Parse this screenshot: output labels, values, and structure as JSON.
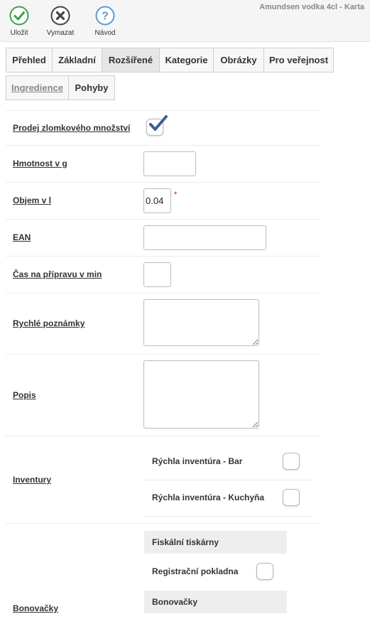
{
  "window": {
    "title": "Amundsen vodka 4cl - Karta"
  },
  "toolbar": {
    "save_label": "Uložit",
    "delete_label": "Vymazat",
    "help_label": "Návod",
    "colors": {
      "save": "#3aa24a",
      "delete": "#444444",
      "help": "#5a9ad6"
    }
  },
  "tabs": [
    {
      "label": "Přehled"
    },
    {
      "label": "Základní"
    },
    {
      "label": "Rozšířené",
      "active": true
    },
    {
      "label": "Kategorie"
    },
    {
      "label": "Obrázky"
    },
    {
      "label": "Pro veřejnost"
    },
    {
      "label": "Ingredience"
    },
    {
      "label": "Pohyby"
    }
  ],
  "form": {
    "fractional_sale": {
      "label": "Prodej zlomkového množství",
      "checked": true
    },
    "weight": {
      "label": "Hmotnost v g",
      "value": ""
    },
    "volume": {
      "label": "Objem v l",
      "value": "0.04",
      "required_mark": "*"
    },
    "ean": {
      "label": "EAN",
      "value": ""
    },
    "prep_time": {
      "label": "Čas na přípravu v min",
      "value": ""
    },
    "quick_notes": {
      "label": "Rychlé poznámky",
      "value": ""
    },
    "description": {
      "label": "Popis",
      "value": ""
    },
    "inventories": {
      "label": "Inventury",
      "items": [
        {
          "label": "Rýchla inventúra - Bar",
          "checked": false
        },
        {
          "label": "Rýchla inventúra - Kuchyňa",
          "checked": false
        }
      ]
    },
    "vouchers": {
      "label": "Bonovačky",
      "fiscal_header": "Fiskální tiskárny",
      "fiscal_items": [
        {
          "label": "Registrační pokladna",
          "checked": false
        }
      ],
      "voucher_header": "Bonovačky"
    }
  },
  "colors": {
    "check_mark": "#3c5e95",
    "required": "#dd0000"
  }
}
